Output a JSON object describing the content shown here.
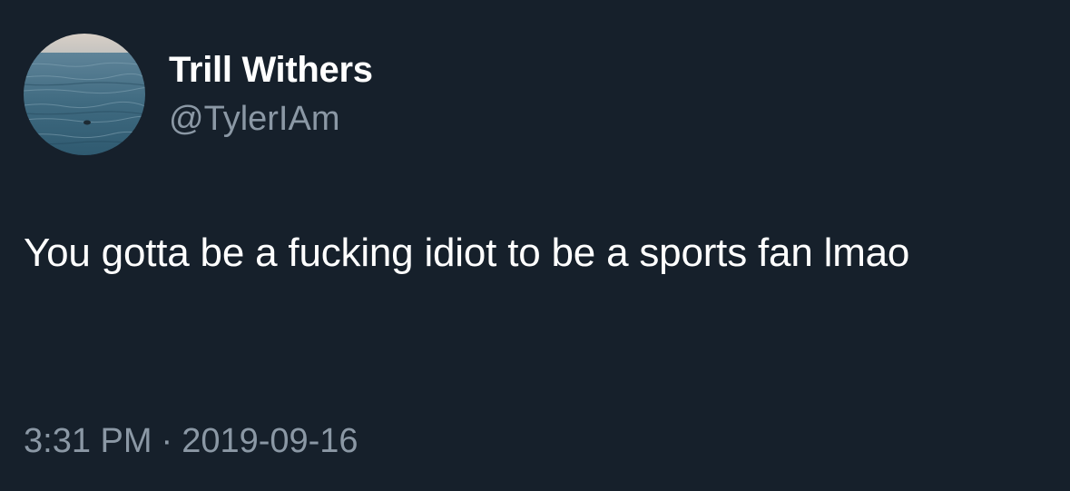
{
  "user": {
    "display_name": "Trill Withers",
    "handle": "@TylerIAm",
    "avatar_icon": "ocean-photo-avatar"
  },
  "tweet": {
    "text": "You gotta be a fucking idiot to be a sports fan lmao",
    "time": "3:31 PM",
    "separator": "·",
    "date": "2019-09-16"
  },
  "colors": {
    "background": "#16202b",
    "primary_text": "#ffffff",
    "secondary_text": "#8b98a5"
  }
}
